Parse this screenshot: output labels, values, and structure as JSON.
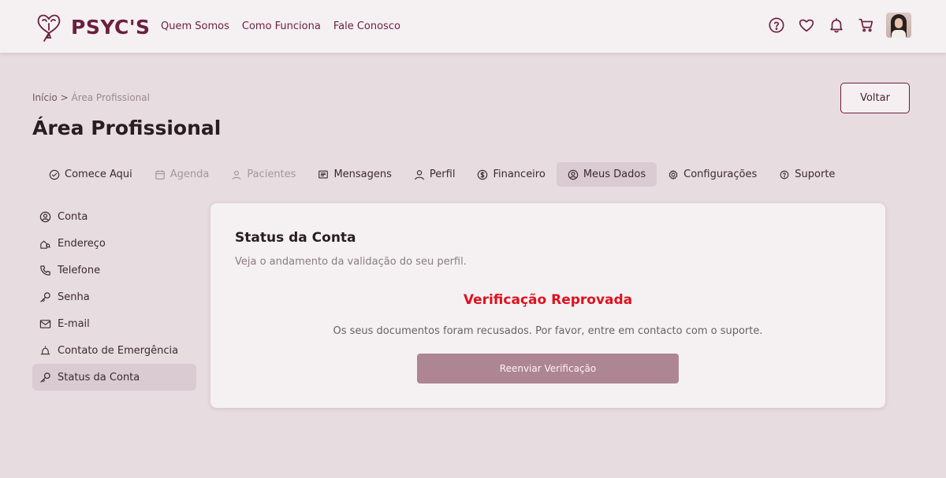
{
  "header": {
    "brand": "PSYC'S",
    "nav": [
      "Quem Somos",
      "Como Funciona",
      "Fale Conosco"
    ],
    "icons": [
      "help-circle-icon",
      "heart-icon",
      "bell-icon",
      "cart-icon"
    ]
  },
  "breadcrumb": {
    "home": "Início",
    "separator": ">",
    "current": "Área Profissional"
  },
  "page_title": "Área Profissional",
  "back_button": "Voltar",
  "tabs": [
    {
      "label": "Comece Aqui",
      "icon": "check-circle-icon",
      "state": "normal"
    },
    {
      "label": "Agenda",
      "icon": "calendar-icon",
      "state": "disabled"
    },
    {
      "label": "Pacientes",
      "icon": "user-icon",
      "state": "disabled"
    },
    {
      "label": "Mensagens",
      "icon": "message-icon",
      "state": "normal"
    },
    {
      "label": "Perfil",
      "icon": "user-icon",
      "state": "normal"
    },
    {
      "label": "Financeiro",
      "icon": "dollar-circle-icon",
      "state": "normal"
    },
    {
      "label": "Meus Dados",
      "icon": "user-circle-icon",
      "state": "active"
    },
    {
      "label": "Configurações",
      "icon": "gear-icon",
      "state": "normal"
    },
    {
      "label": "Suporte",
      "icon": "help-circle-icon",
      "state": "normal"
    }
  ],
  "sidebar": {
    "items": [
      {
        "label": "Conta",
        "icon": "user-circle-icon"
      },
      {
        "label": "Endereço",
        "icon": "home-icon"
      },
      {
        "label": "Telefone",
        "icon": "phone-icon"
      },
      {
        "label": "Senha",
        "icon": "key-icon"
      },
      {
        "label": "E-mail",
        "icon": "mail-icon"
      },
      {
        "label": "Contato de Emergência",
        "icon": "alarm-icon"
      },
      {
        "label": "Status da Conta",
        "icon": "key-icon",
        "active": true
      }
    ]
  },
  "card": {
    "title": "Status da Conta",
    "subtitle": "Veja o andamento da validação do seu perfil.",
    "status_title": "Verificação Reprovada",
    "status_message": "Os seus documentos foram recusados. Por favor, entre em contacto com o suporte.",
    "resend_button": "Reenviar Verificação"
  },
  "colors": {
    "brand": "#6b1f3f",
    "background": "#e7dce0",
    "header_bg": "#f5f0f2",
    "card_bg": "#f5f1f3",
    "active_bg": "#d9cbd1",
    "status_error": "#e0101e",
    "button": "#ad8593"
  }
}
